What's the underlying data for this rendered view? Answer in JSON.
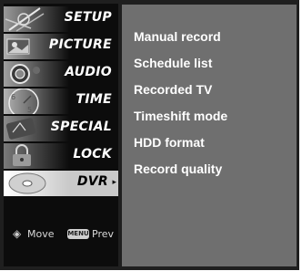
{
  "menu": {
    "items": [
      {
        "label": "SETUP",
        "thumb": "satellite-dish-icon"
      },
      {
        "label": "PICTURE",
        "thumb": "picture-icon"
      },
      {
        "label": "AUDIO",
        "thumb": "speaker-icon"
      },
      {
        "label": "TIME",
        "thumb": "clock-icon"
      },
      {
        "label": "SPECIAL",
        "thumb": "special-icon"
      },
      {
        "label": "LOCK",
        "thumb": "lock-icon"
      },
      {
        "label": "DVR",
        "thumb": "disc-icon",
        "selected": true
      }
    ]
  },
  "submenu": {
    "items": [
      "Manual record",
      "Schedule list",
      "Recorded TV",
      "Timeshift mode",
      "HDD format",
      "Record quality"
    ]
  },
  "footer": {
    "move_icon": "◈",
    "move_label": "Move",
    "menu_key": "MENU",
    "prev_label": "Prev"
  },
  "colors": {
    "background": "#1f1f1f",
    "sidebar": "#0c0c0c",
    "panel": "#6f6f6f",
    "selected_item": "#c9c9c9",
    "text": "#ffffff"
  }
}
